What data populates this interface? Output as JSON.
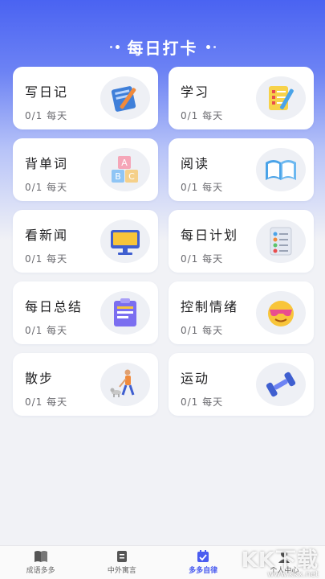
{
  "header": {
    "title": "每日打卡"
  },
  "cards": [
    {
      "title": "写日记",
      "progress": "0/1 每天",
      "icon": "notebook-pen-icon"
    },
    {
      "title": "学习",
      "progress": "0/1 每天",
      "icon": "checklist-pencil-icon"
    },
    {
      "title": "背单词",
      "progress": "0/1 每天",
      "icon": "abc-blocks-icon"
    },
    {
      "title": "阅读",
      "progress": "0/1 每天",
      "icon": "open-book-icon"
    },
    {
      "title": "看新闻",
      "progress": "0/1 每天",
      "icon": "monitor-icon"
    },
    {
      "title": "每日计划",
      "progress": "0/1 每天",
      "icon": "checklist-icon"
    },
    {
      "title": "每日总结",
      "progress": "0/1 每天",
      "icon": "clipboard-icon"
    },
    {
      "title": "控制情绪",
      "progress": "0/1 每天",
      "icon": "sunglasses-emoji-icon"
    },
    {
      "title": "散步",
      "progress": "0/1 每天",
      "icon": "walking-person-dog-icon"
    },
    {
      "title": "运动",
      "progress": "0/1 每天",
      "icon": "dumbbell-icon"
    }
  ],
  "tabbar": {
    "tabs": [
      {
        "label": "成语多多",
        "icon": "book-icon",
        "active": false
      },
      {
        "label": "中外寓言",
        "icon": "document-icon",
        "active": false
      },
      {
        "label": "多多自律",
        "icon": "calendar-check-icon",
        "active": true
      },
      {
        "label": "个人中心",
        "icon": "person-icon",
        "active": false
      }
    ]
  },
  "watermark": {
    "text": "KK下载",
    "url": "www.kkx.net"
  },
  "colors": {
    "accent": "#4a5cf0",
    "hero_top": "#4a63f2",
    "background": "#f1f2f6"
  }
}
